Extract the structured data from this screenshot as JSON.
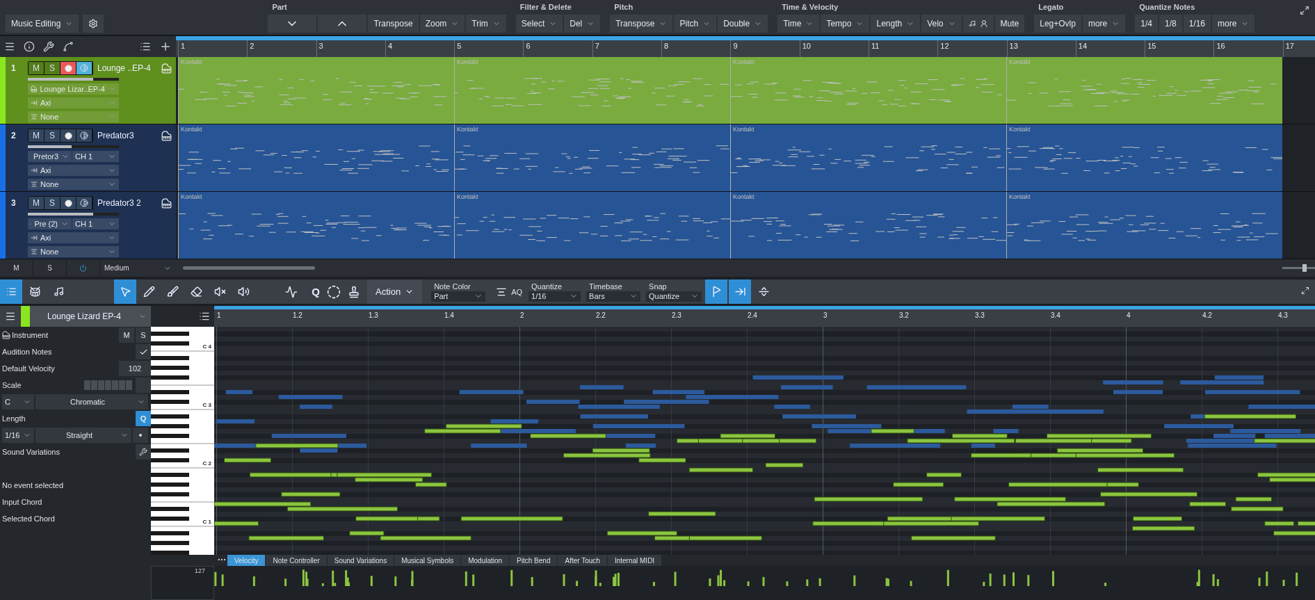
{
  "toolbar": {
    "workspace": "Music Editing",
    "groups": [
      {
        "title": "Part",
        "buttons": [
          {
            "kind": "down"
          },
          {
            "kind": "up"
          },
          {
            "kind": "plain",
            "label": "Transpose"
          },
          {
            "kind": "menu",
            "label": "Zoom"
          },
          {
            "kind": "menu",
            "label": "Trim"
          }
        ]
      },
      {
        "title": "Filter & Delete",
        "buttons": [
          {
            "kind": "menu",
            "label": "Select"
          },
          {
            "kind": "menu",
            "label": "Del"
          }
        ]
      },
      {
        "title": "Pitch",
        "buttons": [
          {
            "kind": "menu",
            "label": "Transpose"
          },
          {
            "kind": "menu",
            "label": "Pitch"
          },
          {
            "kind": "menu",
            "label": "Double"
          }
        ]
      },
      {
        "title": "Time & Velocity",
        "buttons": [
          {
            "kind": "menu",
            "label": "Time"
          },
          {
            "kind": "menu",
            "label": "Tempo"
          },
          {
            "kind": "menu",
            "label": "Length"
          },
          {
            "kind": "menu",
            "label": "Velo"
          },
          {
            "kind": "performer"
          },
          {
            "kind": "plain",
            "label": "Mute"
          }
        ]
      },
      {
        "title": "Legato",
        "buttons": [
          {
            "kind": "plain",
            "label": "Leg+Ovlp"
          },
          {
            "kind": "menu",
            "label": "more"
          }
        ]
      },
      {
        "title": "Quantize Notes",
        "buttons": [
          {
            "kind": "plain",
            "label": "1/4"
          },
          {
            "kind": "plain",
            "label": "1/8"
          },
          {
            "kind": "plain",
            "label": "1/16"
          },
          {
            "kind": "menu",
            "label": "more"
          }
        ]
      }
    ]
  },
  "arrange": {
    "bars": [
      "1",
      "2",
      "3",
      "4",
      "5",
      "6",
      "7",
      "8",
      "9",
      "10",
      "11",
      "12",
      "13",
      "14",
      "15",
      "16",
      "17"
    ],
    "tracks": [
      {
        "number": "1",
        "name": "Lounge ..EP-4",
        "color": "#8ae61e",
        "selected": true,
        "record_armed": true,
        "monitoring": true,
        "level": 0.72,
        "mute": "M",
        "solo": "S",
        "instrument": "Lounge Lizar..EP-4",
        "input": "Axi",
        "output": "None",
        "parts": [
          "Kontakt",
          "Kontakt",
          "Kontakt",
          "Kontakt"
        ]
      },
      {
        "number": "2",
        "name": "Predator3",
        "color": "#1a6fe6",
        "selected": false,
        "record_armed": false,
        "monitoring": false,
        "level": 0.48,
        "mute": "M",
        "solo": "S",
        "instrument": "Pretor3",
        "channel": "CH 1",
        "input": "Axi",
        "output": "None",
        "parts": [
          "Kontakt",
          "Kontakt",
          "Kontakt",
          "Kontakt"
        ]
      },
      {
        "number": "3",
        "name": "Predator3 2",
        "color": "#1a6fe6",
        "selected": false,
        "record_armed": false,
        "monitoring": false,
        "level": 0.72,
        "mute": "M",
        "solo": "S",
        "instrument": "Pre (2)",
        "channel": "CH 1",
        "input": "Axi",
        "output": "None",
        "parts": [
          "Kontakt",
          "Kontakt",
          "Kontakt",
          "Kontakt"
        ]
      }
    ],
    "footer": {
      "mute": "M",
      "solo": "S",
      "size": "Medium",
      "zoom": {
        "level": 0.35
      }
    }
  },
  "edit_toolbar": {
    "views": [
      {
        "kind": "list",
        "selected": true
      },
      {
        "kind": "drum",
        "selected": false
      },
      {
        "kind": "score",
        "selected": false
      }
    ],
    "tools": [
      {
        "kind": "arrow",
        "selected": true
      },
      {
        "kind": "pencil",
        "selected": false
      },
      {
        "kind": "paint",
        "selected": false
      },
      {
        "kind": "eraser",
        "selected": false
      },
      {
        "kind": "mute",
        "selected": false
      },
      {
        "kind": "listen",
        "selected": false
      }
    ],
    "q": "Q",
    "action": "Action",
    "note_color": {
      "label": "Note Color",
      "value": "Part"
    },
    "aq": "AQ",
    "quantize": {
      "label": "Quantize",
      "value": "1/16"
    },
    "timebase": {
      "label": "Timebase",
      "value": "Bars"
    },
    "snap": {
      "label": "Snap",
      "value": "Quantize"
    },
    "snap_buttons": [
      {
        "kind": "flag",
        "selected": true
      },
      {
        "kind": "end",
        "selected": true
      },
      {
        "kind": "split",
        "selected": false
      }
    ]
  },
  "inspector": {
    "track": "Lounge Lizard EP-4",
    "color": "#8ae61e",
    "instrument": "Instrument",
    "mute": "M",
    "solo": "S",
    "audition": {
      "label": "Audition Notes",
      "checked": true
    },
    "velocity": {
      "label": "Default Velocity",
      "value": "102"
    },
    "scale": {
      "label": "Scale",
      "root": "C",
      "type": "Chromatic"
    },
    "length": {
      "label": "Length",
      "button": "Q",
      "quantize_on": true,
      "value": "1/16",
      "feel": "Straight"
    },
    "sound_variations": "Sound Variations",
    "event": "No event selected",
    "input_chord": "Input Chord",
    "selected_chord": "Selected Chord"
  },
  "editor": {
    "ruler": [
      "1",
      "1.2",
      "1.3",
      "1.4",
      "2",
      "2.2",
      "2.3",
      "2.4",
      "3",
      "3.2",
      "3.3",
      "3.4",
      "4",
      "4.2",
      "4.3"
    ],
    "octaves": [
      "C 4",
      "C 3",
      "C 2",
      "C 1"
    ],
    "lane_tabs": [
      {
        "label": "Velocity",
        "selected": true
      },
      {
        "label": "Note Controller",
        "selected": false
      },
      {
        "label": "Sound Variations",
        "selected": false
      },
      {
        "label": "Musical Symbols",
        "selected": false
      },
      {
        "label": "Modulation",
        "selected": false
      },
      {
        "label": "Pitch Bend",
        "selected": false
      },
      {
        "label": "After Touch",
        "selected": false
      },
      {
        "label": "Internal MIDI",
        "selected": false
      }
    ],
    "lane_max": "127"
  }
}
